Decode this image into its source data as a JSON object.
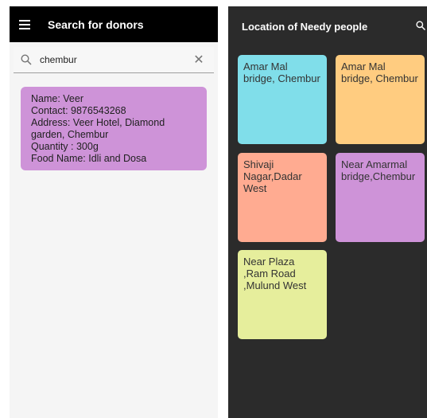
{
  "donor_search": {
    "title": "Search for donors",
    "search_value": "chembur",
    "results": [
      {
        "name": "Name: Veer",
        "contact": "Contact: 9876543268",
        "address_line1": "Address: Veer Hotel, Diamond",
        "address_line2": "garden, Chembur",
        "quantity": "Quantity : 300g",
        "food": "Food Name: Idli and Dosa"
      }
    ]
  },
  "needy_locations": {
    "title": "Location of Needy people",
    "items": [
      {
        "location": "Amar Mal bridge, Chembur",
        "color": "#80deea"
      },
      {
        "location": "Amar Mal bridge, Chembur",
        "color": "#ffcc80"
      },
      {
        "location": "Shivaji Nagar,Dadar West",
        "color": "#ffab91"
      },
      {
        "location": "Near Amarmal bridge,Chembur",
        "color": "#ce93d8"
      },
      {
        "location": "Near Plaza ,Ram Road ,Mulund West",
        "color": "#e6ee9c"
      }
    ]
  },
  "colors": {
    "left_appbar": "#000000",
    "right_background": "#2b2b2b",
    "donor_card": "#ce93d8"
  },
  "icons": [
    "menu-icon",
    "search-icon",
    "close-icon"
  ]
}
